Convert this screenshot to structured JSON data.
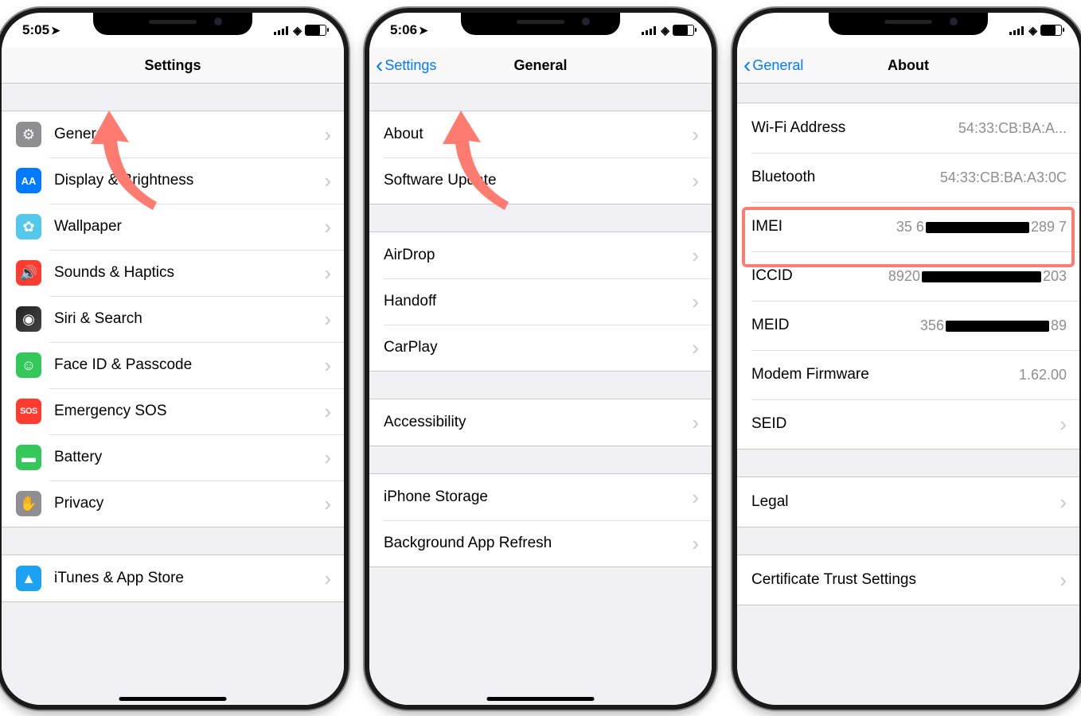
{
  "phone1": {
    "time": "5:05",
    "title": "Settings",
    "items": [
      {
        "label": "General"
      },
      {
        "label": "Display & Brightness"
      },
      {
        "label": "Wallpaper"
      },
      {
        "label": "Sounds & Haptics"
      },
      {
        "label": "Siri & Search"
      },
      {
        "label": "Face ID & Passcode"
      },
      {
        "label": "Emergency SOS"
      },
      {
        "label": "Battery"
      },
      {
        "label": "Privacy"
      },
      {
        "label": "iTunes & App Store"
      }
    ]
  },
  "phone2": {
    "time": "5:06",
    "back": "Settings",
    "title": "General",
    "groups": [
      [
        "About",
        "Software Update"
      ],
      [
        "AirDrop",
        "Handoff",
        "CarPlay"
      ],
      [
        "Accessibility"
      ],
      [
        "iPhone Storage",
        "Background App Refresh"
      ]
    ]
  },
  "phone3": {
    "back": "General",
    "title": "About",
    "rows": [
      {
        "label": "Wi-Fi Address",
        "value": "54:33:CB:BA:A...",
        "chev": false
      },
      {
        "label": "Bluetooth",
        "value": "54:33:CB:BA:A3:0C",
        "chev": false
      },
      {
        "label": "IMEI",
        "prefix": "35 6",
        "suffix": "289 7",
        "scribble": 130,
        "chev": false
      },
      {
        "label": "ICCID",
        "prefix": "8920",
        "suffix": "203",
        "scribble": 150,
        "chev": false
      },
      {
        "label": "MEID",
        "prefix": "356",
        "suffix": "89",
        "scribble": 130,
        "chev": false
      },
      {
        "label": "Modem Firmware",
        "value": "1.62.00",
        "chev": false
      },
      {
        "label": "SEID",
        "value": "",
        "chev": true
      },
      {
        "label": "Legal",
        "value": "",
        "chev": true,
        "gapBefore": true
      },
      {
        "label": "Certificate Trust Settings",
        "value": "",
        "chev": true,
        "gapBefore": true
      }
    ]
  }
}
